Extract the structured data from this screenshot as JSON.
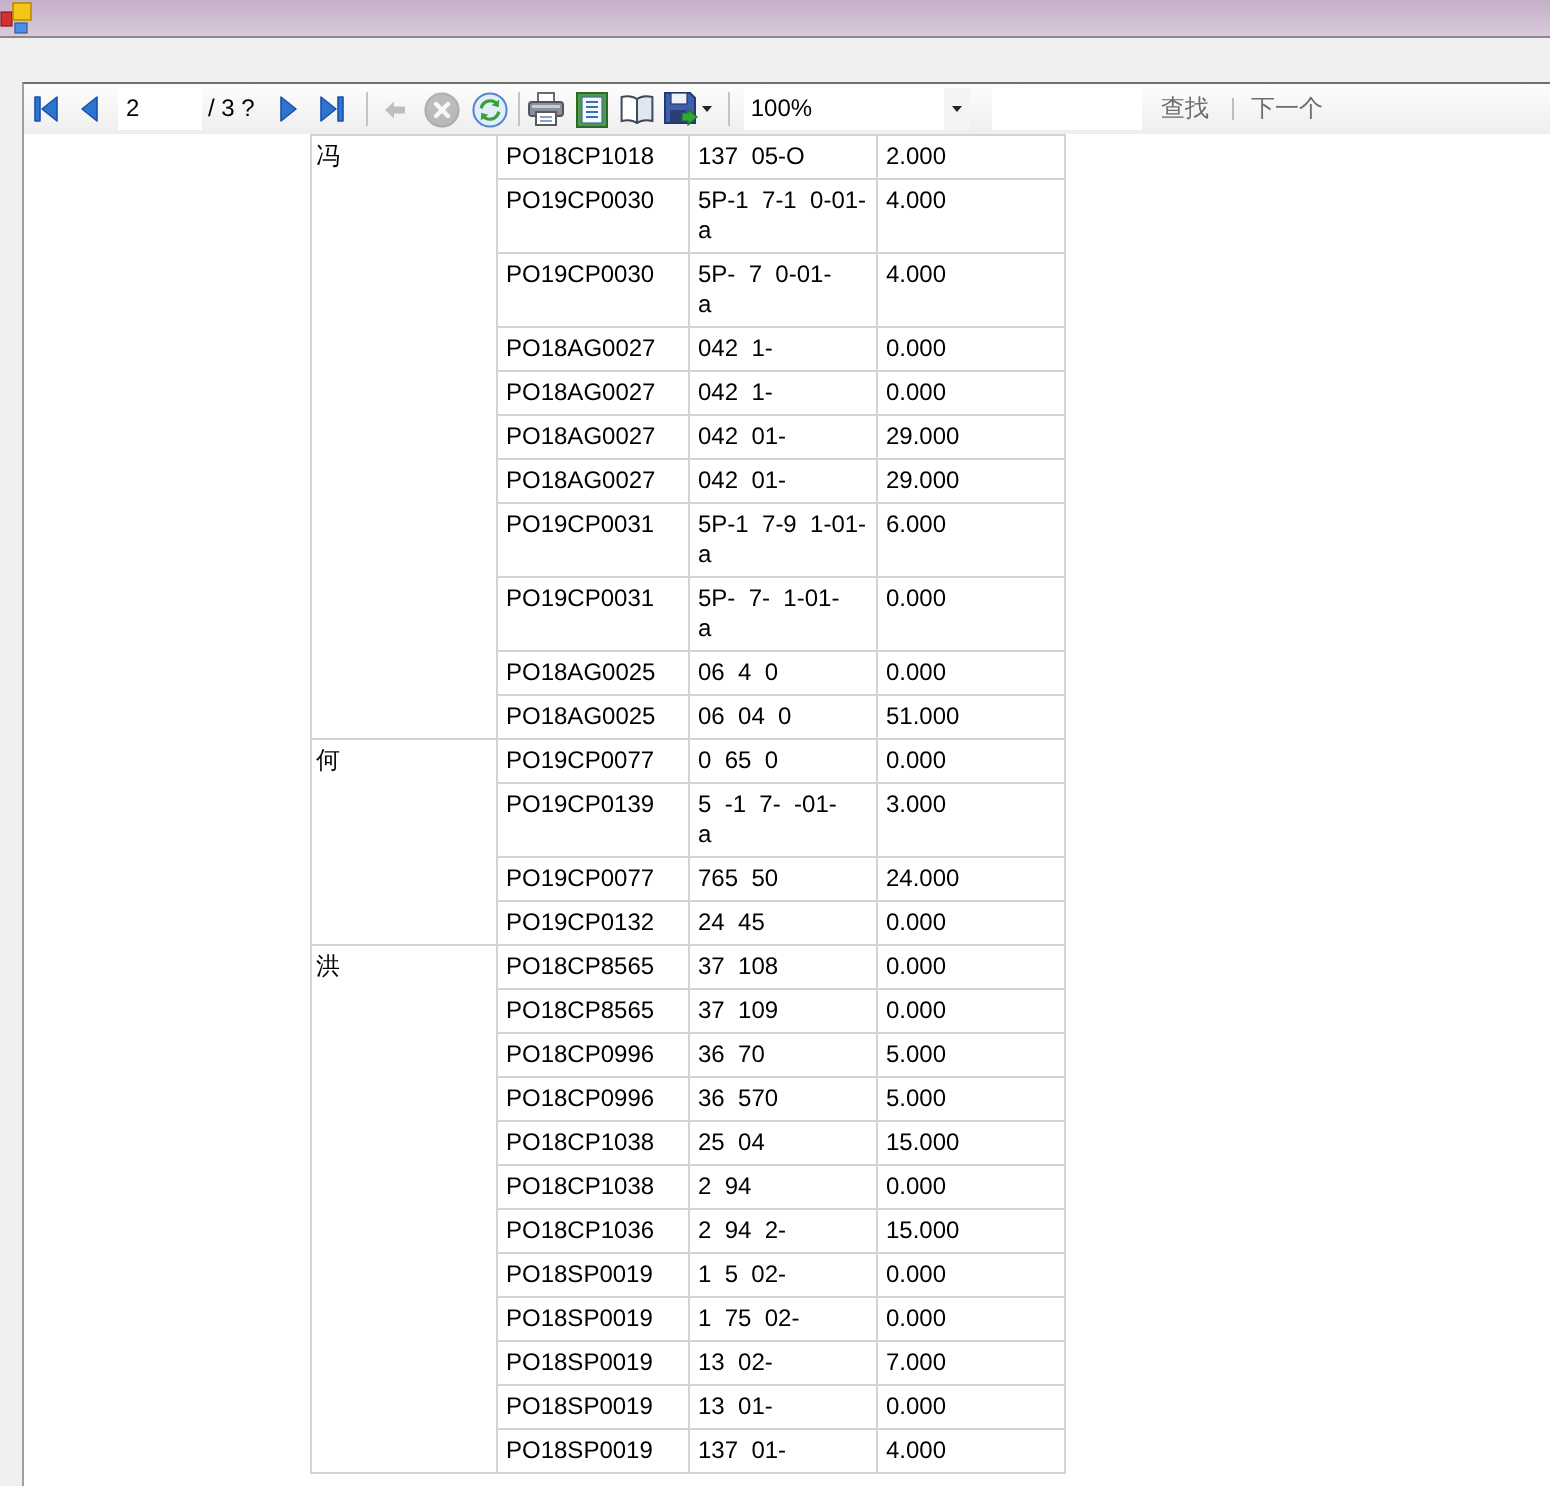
{
  "toolbar": {
    "items": [
      {
        "kind": "first_page",
        "disabled": false
      },
      {
        "kind": "previous_page",
        "disabled": false
      },
      {
        "kind": "page_field",
        "value": "2"
      },
      {
        "kind": "label",
        "text": "/ 3 ?"
      },
      {
        "kind": "next_page",
        "disabled": false
      },
      {
        "kind": "last_page",
        "disabled": false
      },
      {
        "kind": "separator"
      },
      {
        "kind": "back",
        "disabled": true
      },
      {
        "kind": "stop",
        "disabled": true
      },
      {
        "kind": "refresh",
        "disabled": false
      },
      {
        "kind": "separator"
      },
      {
        "kind": "print",
        "disabled": false
      },
      {
        "kind": "page_layout",
        "disabled": false
      },
      {
        "kind": "page_setup",
        "disabled": false
      },
      {
        "kind": "export",
        "disabled": false
      },
      {
        "kind": "separator"
      },
      {
        "kind": "zoom",
        "value": "100%"
      },
      {
        "kind": "find_field"
      },
      {
        "kind": "find",
        "label": "查找",
        "disabled": true
      },
      {
        "kind": "link_separator"
      },
      {
        "kind": "find_next",
        "label": "下一个",
        "disabled": true
      }
    ]
  },
  "report": {
    "groups": [
      {
        "column_1": "冯",
        "rows": [
          {
            "column_2": "PO18CP1018",
            "column_3": "137  05-O",
            "column_4": "2.000"
          },
          {
            "column_2": "PO19CP0030",
            "column_3": "5P-1  7-1  0-01-\na",
            "column_4": "4.000"
          },
          {
            "column_2": "PO19CP0030",
            "column_3": "5P-  7  0-01-\na",
            "column_4": "4.000"
          },
          {
            "column_2": "PO18AG0027",
            "column_3": "042  1-",
            "column_4": "0.000"
          },
          {
            "column_2": "PO18AG0027",
            "column_3": "042  1-",
            "column_4": "0.000"
          },
          {
            "column_2": "PO18AG0027",
            "column_3": "042  01-",
            "column_4": "29.000"
          },
          {
            "column_2": "PO18AG0027",
            "column_3": "042  01-",
            "column_4": "29.000"
          },
          {
            "column_2": "PO19CP0031",
            "column_3": "5P-1  7-9  1-01-\na",
            "column_4": "6.000"
          },
          {
            "column_2": "PO19CP0031",
            "column_3": "5P-  7-  1-01-\na",
            "column_4": "0.000"
          },
          {
            "column_2": "PO18AG0025",
            "column_3": "06  4  0",
            "column_4": "0.000"
          },
          {
            "column_2": "PO18AG0025",
            "column_3": "06  04  0",
            "column_4": "51.000"
          }
        ]
      },
      {
        "column_1": "何",
        "rows": [
          {
            "column_2": "PO19CP0077",
            "column_3": "0  65  0",
            "column_4": "0.000"
          },
          {
            "column_2": "PO19CP0139",
            "column_3": "5  -1  7-  -01-\na",
            "column_4": "3.000"
          },
          {
            "column_2": "PO19CP0077",
            "column_3": "765  50",
            "column_4": "24.000"
          },
          {
            "column_2": "PO19CP0132",
            "column_3": "24  45",
            "column_4": "0.000"
          }
        ]
      },
      {
        "column_1": "洪",
        "rows": [
          {
            "column_2": "PO18CP8565",
            "column_3": "37  108",
            "column_4": "0.000"
          },
          {
            "column_2": "PO18CP8565",
            "column_3": "37  109",
            "column_4": "0.000"
          },
          {
            "column_2": "PO18CP0996",
            "column_3": "36  70",
            "column_4": "5.000"
          },
          {
            "column_2": "PO18CP0996",
            "column_3": "36  570",
            "column_4": "5.000"
          },
          {
            "column_2": "PO18CP1038",
            "column_3": "25  04",
            "column_4": "15.000"
          },
          {
            "column_2": "PO18CP1038",
            "column_3": "2  94",
            "column_4": "0.000"
          },
          {
            "column_2": "PO18CP1036",
            "column_3": "2  94  2-",
            "column_4": "15.000"
          },
          {
            "column_2": "PO18SP0019",
            "column_3": "1  5  02-",
            "column_4": "0.000"
          },
          {
            "column_2": "PO18SP0019",
            "column_3": "1  75  02-",
            "column_4": "0.000"
          },
          {
            "column_2": "PO18SP0019",
            "column_3": "13  02-",
            "column_4": "7.000"
          },
          {
            "column_2": "PO18SP0019",
            "column_3": "13  01-",
            "column_4": "0.000"
          },
          {
            "column_2": "PO18SP0019",
            "column_3": "137  01-",
            "column_4": "4.000"
          }
        ]
      }
    ]
  }
}
